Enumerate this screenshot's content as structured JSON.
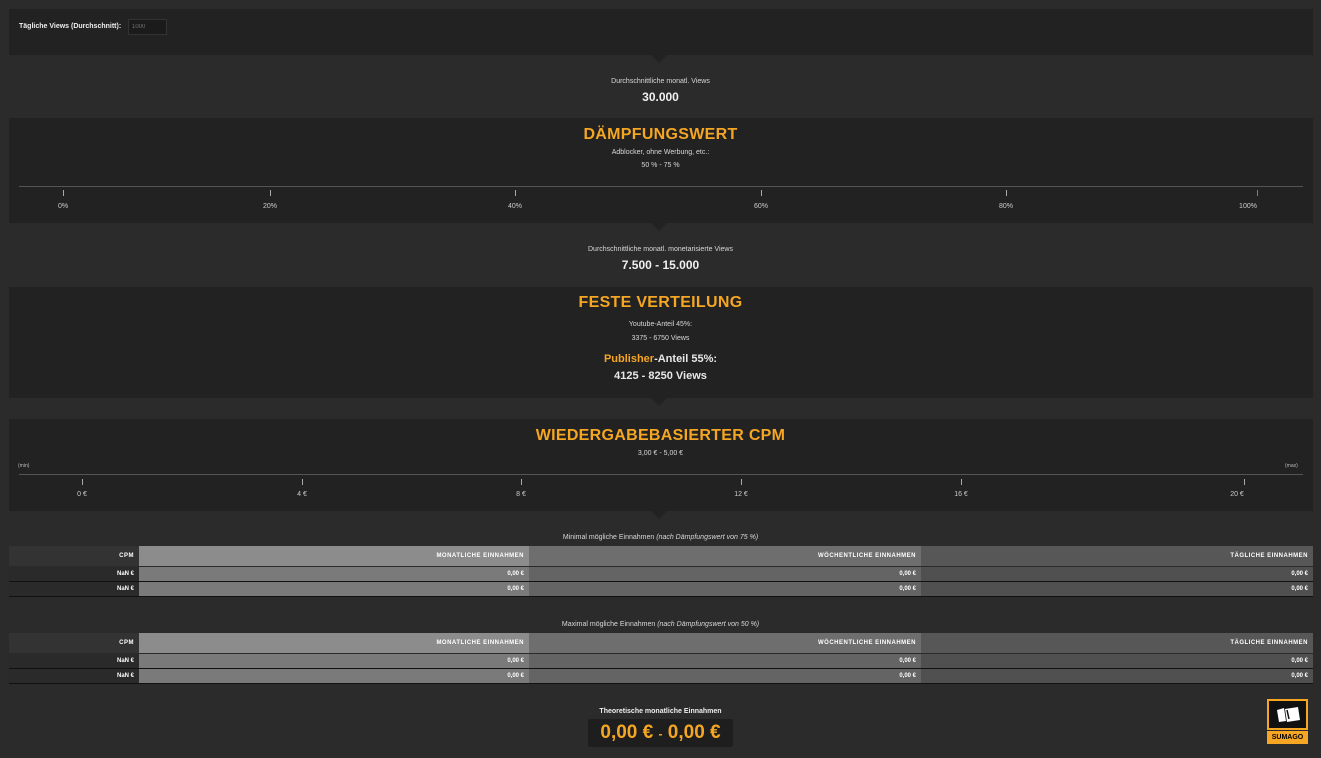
{
  "input": {
    "label": "Tägliche Views (Durchschnitt):",
    "placeholder": "1000"
  },
  "monthly_views": {
    "label": "Durchschnittliche monatl. Views",
    "value": "30.000"
  },
  "damping": {
    "title": "DÄMPFUNGSWERT",
    "subtitle": "Adblocker, ohne Werbung, etc.:",
    "range": "50 % - 75 %",
    "ticks": [
      "0%",
      "20%",
      "40%",
      "60%",
      "80%",
      "100%"
    ]
  },
  "monetized_views": {
    "label": "Durchschnittliche monatl. monetarisierte Views",
    "value": "7.500 - 15.000"
  },
  "distribution": {
    "title": "FESTE VERTEILUNG",
    "youtube_label": "Youtube-Anteil 45%:",
    "youtube_views": "3375 - 6750 Views",
    "publisher_word": "Publisher",
    "publisher_rest": "-Anteil 55%:",
    "publisher_views": "4125 - 8250 Views"
  },
  "cpm": {
    "title": "WIEDERGABEBASIERTER CPM",
    "range": "3,00 € - 5,00 €",
    "min_label": "(min)",
    "max_label": "(max)",
    "ticks": [
      "0 €",
      "4 €",
      "8 €",
      "12 €",
      "16 €",
      "20 €"
    ]
  },
  "min_table": {
    "caption_main": "Minimal mögliche Einnahmen ",
    "caption_italic": "(nach Dämpfungswert von 75 %)",
    "headers": [
      "CPM",
      "MONATLICHE EINNAHMEN",
      "WÖCHENTLICHE EINNAHMEN",
      "TÄGLICHE EINNAHMEN"
    ],
    "rows": [
      [
        "NaN €",
        "0,00 €",
        "0,00 €",
        "0,00 €"
      ],
      [
        "NaN €",
        "0,00 €",
        "0,00 €",
        "0,00 €"
      ]
    ]
  },
  "max_table": {
    "caption_main": "Maximal mögliche Einnahmen ",
    "caption_italic": "(nach Dämpfungswert von 50 %)",
    "headers": [
      "CPM",
      "MONATLICHE EINNAHMEN",
      "WÖCHENTLICHE EINNAHMEN",
      "TÄGLICHE EINNAHMEN"
    ],
    "rows": [
      [
        "NaN €",
        "0,00 €",
        "0,00 €",
        "0,00 €"
      ],
      [
        "NaN €",
        "0,00 €",
        "0,00 €",
        "0,00 €"
      ]
    ]
  },
  "result": {
    "label": "Theoretische monatliche Einnahmen",
    "min": "0,00 €",
    "sep": "-",
    "max": "0,00 €"
  },
  "logo": {
    "text": "SUMAGO"
  },
  "colors": {
    "accent": "#f5a623",
    "panel": "#222222",
    "background": "#2b2b2b"
  }
}
